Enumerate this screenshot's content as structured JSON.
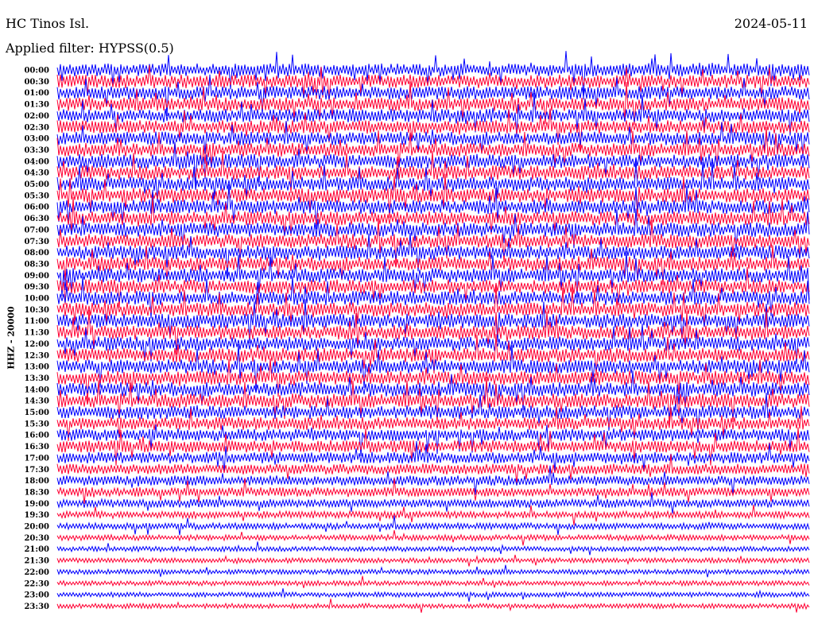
{
  "header": {
    "station": "HC Tinos Isl.",
    "filter_label": "Applied filter: HYPSS(0.5)",
    "date": "2024-05-11"
  },
  "chart_data": {
    "type": "line",
    "title": "HC Tinos Isl.",
    "subtitle": "Applied filter: HYPSS(0.5)",
    "date": "2024-05-11",
    "ylabel": "HHZ - 20000",
    "y_ticks": [
      "00:00",
      "00:30",
      "01:00",
      "01:30",
      "02:00",
      "02:30",
      "03:00",
      "03:30",
      "04:00",
      "04:30",
      "05:00",
      "05:30",
      "06:00",
      "06:30",
      "07:00",
      "07:30",
      "08:00",
      "08:30",
      "09:00",
      "09:30",
      "10:00",
      "10:30",
      "11:00",
      "11:30",
      "12:00",
      "12:30",
      "13:00",
      "13:30",
      "14:00",
      "14:30",
      "15:00",
      "15:30",
      "16:00",
      "16:30",
      "17:00",
      "17:30",
      "18:00",
      "18:30",
      "19:00",
      "19:30",
      "20:00",
      "20:30",
      "21:00",
      "21:30",
      "22:00",
      "22:30",
      "23:00",
      "23:30"
    ],
    "series_colors": [
      "#0000ff",
      "#ff0033"
    ],
    "amplitude_profile": [
      0.9,
      0.95,
      0.95,
      0.95,
      0.95,
      0.95,
      0.95,
      0.95,
      1.0,
      1.0,
      1.0,
      1.0,
      1.0,
      1.0,
      1.0,
      1.0,
      1.0,
      1.0,
      1.0,
      1.0,
      1.0,
      1.0,
      1.0,
      1.0,
      1.0,
      1.0,
      1.0,
      1.0,
      1.0,
      1.0,
      0.95,
      0.9,
      0.85,
      0.85,
      0.8,
      0.75,
      0.7,
      0.65,
      0.6,
      0.5,
      0.45,
      0.4,
      0.35,
      0.35,
      0.35,
      0.35,
      0.35,
      0.35
    ],
    "grid": false,
    "legend": "none"
  }
}
